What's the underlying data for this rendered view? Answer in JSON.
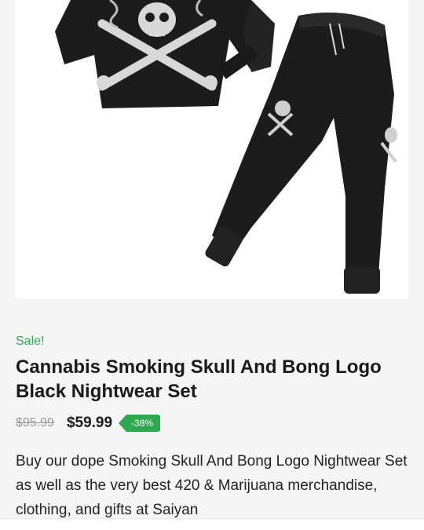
{
  "product": {
    "sale_label": "Sale!",
    "title": "Cannabis Smoking Skull And Bong Logo Black Nightwear Set",
    "old_price": "$95.99",
    "new_price": "$59.99",
    "discount_badge": "-38%",
    "description": "Buy our dope Smoking Skull And Bong Logo Nightwear Set as well as the very best 420 & Marijuana merchandise, clothing, and gifts at Saiyan"
  },
  "colors": {
    "accent": "#2fa84f",
    "garment": "#1c1c1c",
    "background": "#f5f5f5"
  },
  "image": {
    "icon": "product-photo-nightwear-set"
  }
}
